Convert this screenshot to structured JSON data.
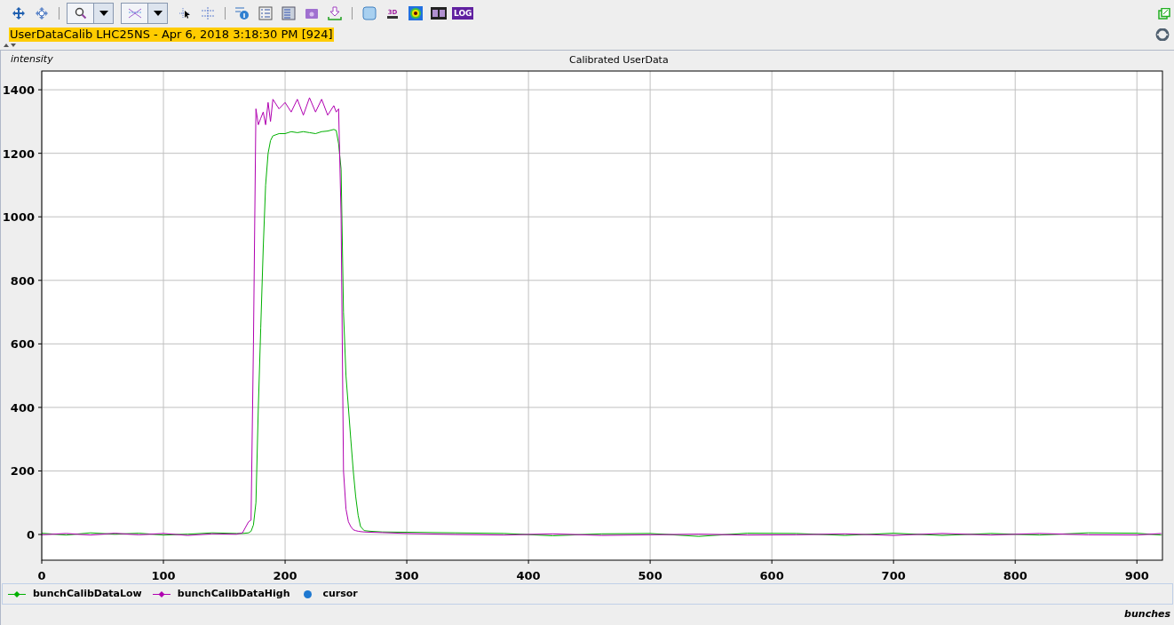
{
  "toolbar": {
    "badge_3d": "3D",
    "badge_log": "LOG"
  },
  "header": {
    "title": "UserDataCalib LHC25NS - Apr 6, 2018 3:18:30 PM [924]"
  },
  "chart": {
    "chart_data": {
      "type": "line",
      "title": "Calibrated UserData",
      "xlabel": "bunches",
      "ylabel": "intensity",
      "grid": true,
      "x": [
        0,
        20,
        40,
        60,
        80,
        100,
        120,
        140,
        160,
        165,
        170,
        172,
        174,
        176,
        178,
        180,
        182,
        184,
        186,
        188,
        190,
        195,
        200,
        205,
        210,
        215,
        220,
        225,
        230,
        235,
        240,
        242,
        244,
        246,
        248,
        250,
        252,
        254,
        256,
        258,
        260,
        262,
        265,
        270,
        280,
        300,
        340,
        380,
        420,
        460,
        500,
        540,
        580,
        620,
        660,
        700,
        740,
        780,
        820,
        860,
        900,
        920
      ],
      "series": [
        {
          "name": "bunchCalibDataLow",
          "color": "#00b000",
          "values": [
            4,
            -2,
            5,
            1,
            4,
            -2,
            1,
            5,
            3,
            3,
            5,
            10,
            30,
            100,
            400,
            650,
            900,
            1100,
            1200,
            1240,
            1255,
            1262,
            1262,
            1268,
            1265,
            1268,
            1265,
            1262,
            1268,
            1270,
            1275,
            1272,
            1230,
            1150,
            700,
            500,
            400,
            300,
            200,
            120,
            60,
            25,
            12,
            10,
            8,
            7,
            5,
            3,
            -4,
            2,
            3,
            -6,
            4,
            3,
            -3,
            4,
            -3,
            3,
            -2,
            5,
            4,
            -2
          ]
        },
        {
          "name": "bunchCalibDataHigh",
          "color": "#b000b0",
          "values": [
            -1,
            3,
            -2,
            4,
            -1,
            3,
            -3,
            2,
            1,
            5,
            40,
            45,
            600,
            1340,
            1290,
            1310,
            1330,
            1290,
            1360,
            1300,
            1370,
            1340,
            1360,
            1330,
            1370,
            1320,
            1375,
            1330,
            1370,
            1320,
            1350,
            1330,
            1340,
            1000,
            200,
            80,
            40,
            25,
            15,
            12,
            10,
            9,
            8,
            7,
            6,
            3,
            0,
            -2,
            2,
            -3,
            -1,
            1,
            -2,
            -1,
            2,
            -3,
            3,
            -2,
            3,
            -1,
            -2,
            3
          ]
        }
      ],
      "xlim": [
        0,
        921
      ],
      "ylim": [
        -81,
        1459
      ],
      "xticks": [
        0,
        100,
        200,
        300,
        400,
        500,
        600,
        700,
        800,
        900
      ],
      "yticks": [
        0,
        200,
        400,
        600,
        800,
        1000,
        1200,
        1400
      ]
    },
    "cursor_legend": {
      "label": "cursor",
      "color": "#1e78d0"
    }
  }
}
